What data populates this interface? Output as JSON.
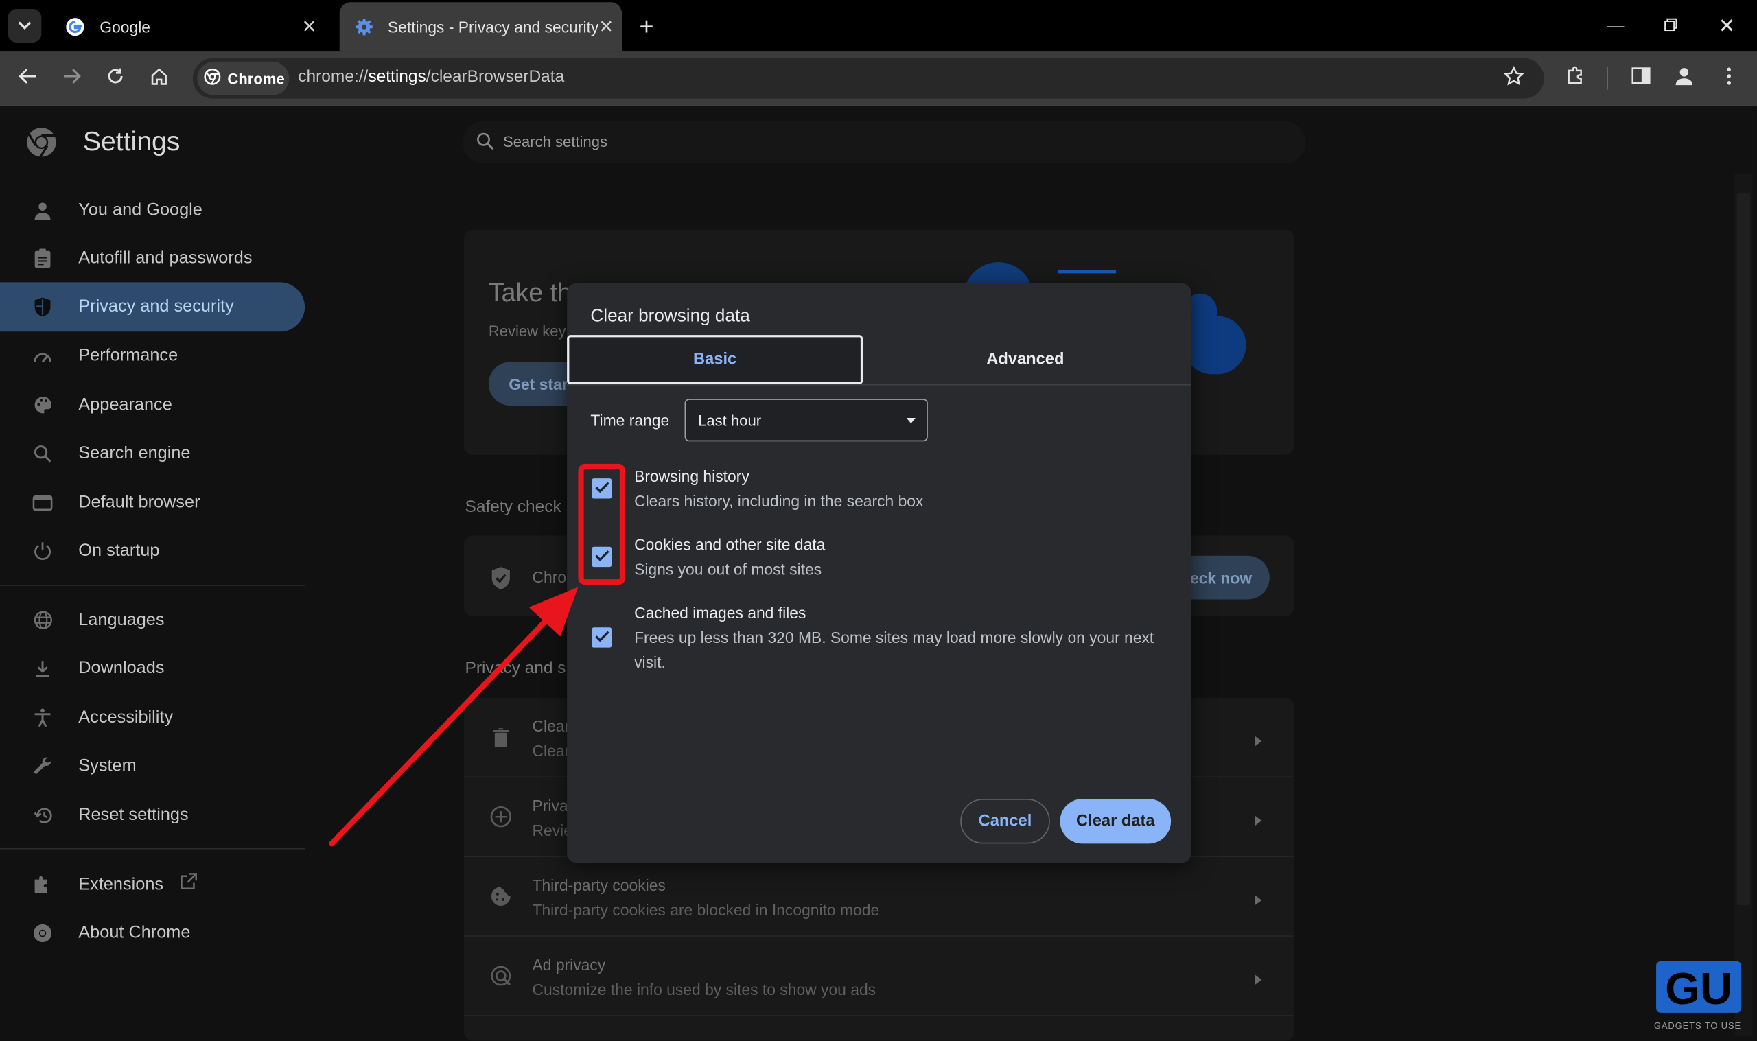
{
  "browser": {
    "tabs": [
      {
        "title": "Google",
        "favicon": "google-g-icon"
      },
      {
        "title": "Settings - Privacy and security",
        "favicon": "gear-icon",
        "active": true
      }
    ],
    "omnibox": {
      "chip_label": "Chrome",
      "url_scheme": "chrome://",
      "url_host": "settings",
      "url_path": "/clearBrowserData"
    }
  },
  "settings": {
    "title": "Settings",
    "search_placeholder": "Search settings",
    "nav": [
      {
        "label": "You and Google",
        "icon": "person-icon"
      },
      {
        "label": "Autofill and passwords",
        "icon": "clipboard-icon"
      },
      {
        "label": "Privacy and security",
        "icon": "shield-icon",
        "active": true
      },
      {
        "label": "Performance",
        "icon": "speedometer-icon"
      },
      {
        "label": "Appearance",
        "icon": "palette-icon"
      },
      {
        "label": "Search engine",
        "icon": "search-icon"
      },
      {
        "label": "Default browser",
        "icon": "browser-window-icon"
      },
      {
        "label": "On startup",
        "icon": "power-icon"
      },
      {
        "label": "Languages",
        "icon": "globe-icon"
      },
      {
        "label": "Downloads",
        "icon": "download-icon"
      },
      {
        "label": "Accessibility",
        "icon": "accessibility-icon"
      },
      {
        "label": "System",
        "icon": "wrench-icon"
      },
      {
        "label": "Reset settings",
        "icon": "reset-icon"
      },
      {
        "label": "Extensions",
        "icon": "puzzle-icon"
      },
      {
        "label": "About Chrome",
        "icon": "chrome-logo-icon"
      }
    ],
    "background": {
      "promo_title_partial": "Take th",
      "promo_sub_partial": "Review key",
      "promo_button_partial": "Get star",
      "safety_check_heading": "Safety check",
      "safety_row_partial": "Chro",
      "check_now_partial": "eck now",
      "privacy_heading_partial": "Privacy and s",
      "rows": [
        {
          "title": "Clear",
          "subtitle": "Clear"
        },
        {
          "title": "Priva",
          "subtitle": "Revie"
        },
        {
          "title": "Third-party cookies",
          "subtitle": "Third-party cookies are blocked in Incognito mode"
        },
        {
          "title": "Ad privacy",
          "subtitle": "Customize the info used by sites to show you ads"
        }
      ]
    }
  },
  "dialog": {
    "title": "Clear browsing data",
    "tabs": [
      "Basic",
      "Advanced"
    ],
    "time_range_label": "Time range",
    "time_range_value": "Last hour",
    "options": [
      {
        "title": "Browsing history",
        "subtitle": "Clears history, including in the search box",
        "checked": true
      },
      {
        "title": "Cookies and other site data",
        "subtitle": "Signs you out of most sites",
        "checked": true
      },
      {
        "title": "Cached images and files",
        "subtitle": "Frees up less than 320 MB. Some sites may load more slowly on your next visit.",
        "checked": true
      }
    ],
    "cancel_label": "Cancel",
    "confirm_label": "Clear data"
  },
  "watermark": {
    "logo_text": "GU",
    "caption": "GADGETS TO USE"
  },
  "colors": {
    "accent": "#8ab4f8",
    "annotation": "#e8161c",
    "active_nav_bg": "#2e4b6e"
  }
}
